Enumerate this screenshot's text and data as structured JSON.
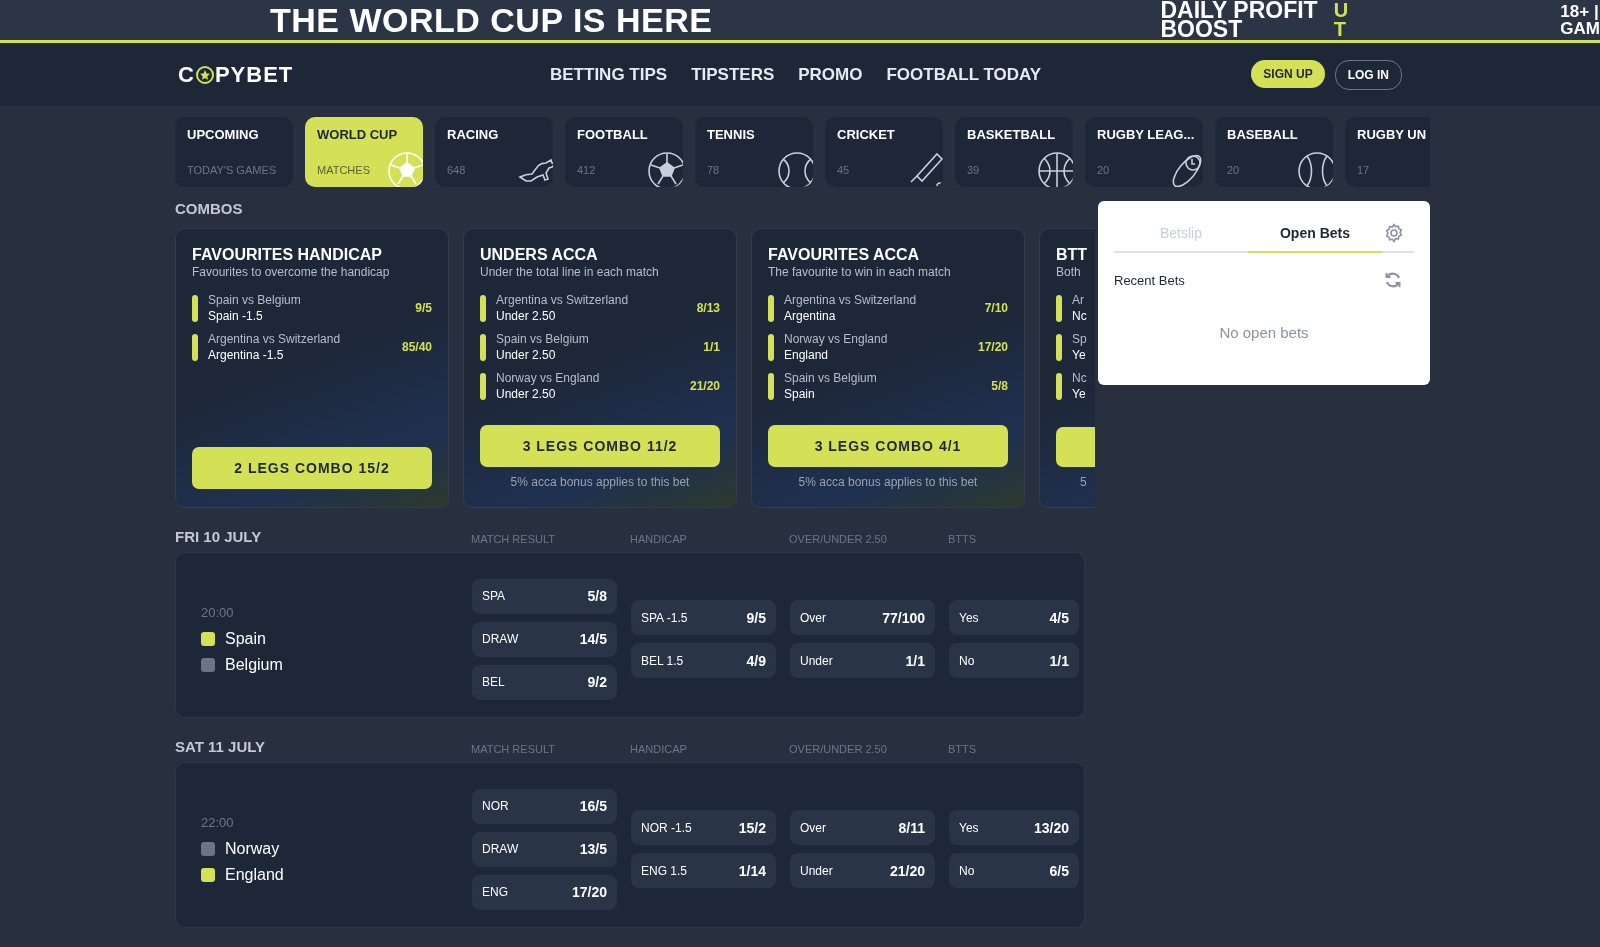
{
  "banner": {
    "headline": "THE WORLD CUP IS HERE",
    "promo_line_1": "DAILY PROFIT",
    "promo_line_2": "BOOST",
    "accent_1": "U",
    "accent_2": "T",
    "age_1": "18+ |",
    "age_2": "GAM"
  },
  "nav": {
    "logo_start": "C",
    "logo_end": "PYBET",
    "links": [
      "BETTING TIPS",
      "TIPSTERS",
      "PROMO",
      "FOOTBALL TODAY"
    ],
    "sign_up": "SIGN UP",
    "log_in": "LOG IN"
  },
  "categories": [
    {
      "title": "UPCOMING",
      "subtitle": "TODAY'S GAMES",
      "selected": false
    },
    {
      "title": "WORLD CUP",
      "subtitle": "MATCHES",
      "selected": true,
      "kind": "soccer"
    },
    {
      "title": "RACING",
      "subtitle": "648",
      "selected": false,
      "kind": "horse"
    },
    {
      "title": "FOOTBALL",
      "subtitle": "412",
      "selected": false,
      "kind": "soccer"
    },
    {
      "title": "TENNIS",
      "subtitle": "78",
      "selected": false,
      "kind": "tennis"
    },
    {
      "title": "CRICKET",
      "subtitle": "45",
      "selected": false,
      "kind": "cricket"
    },
    {
      "title": "BASKETBALL",
      "subtitle": "39",
      "selected": false,
      "kind": "basketball"
    },
    {
      "title": "RUGBY LEAG...",
      "subtitle": "20",
      "selected": false,
      "kind": "rugby"
    },
    {
      "title": "BASEBALL",
      "subtitle": "20",
      "selected": false,
      "kind": "baseball"
    },
    {
      "title": "RUGBY UN",
      "subtitle": "17",
      "selected": false
    }
  ],
  "combos": {
    "heading": "COMBOS",
    "cards": [
      {
        "title": "FAVOURITES HANDICAP",
        "subtitle": "Favourites to overcome the handicap",
        "legs": [
          {
            "match": "Spain vs Belgium",
            "pick": "Spain -1.5",
            "odds": "9/5"
          },
          {
            "match": "Argentina vs Switzerland",
            "pick": "Argentina -1.5",
            "odds": "85/40"
          }
        ],
        "button": "2 LEGS COMBO 15/2"
      },
      {
        "title": "UNDERS ACCA",
        "subtitle": "Under the total line in each match",
        "legs": [
          {
            "match": "Argentina vs Switzerland",
            "pick": "Under 2.50",
            "odds": "8/13"
          },
          {
            "match": "Spain vs Belgium",
            "pick": "Under 2.50",
            "odds": "1/1"
          },
          {
            "match": "Norway vs England",
            "pick": "Under 2.50",
            "odds": "21/20"
          }
        ],
        "button": "3 LEGS COMBO 11/2",
        "note": "5% acca bonus applies to this bet"
      },
      {
        "title": "FAVOURITES ACCA",
        "subtitle": "The favourite to win in each match",
        "legs": [
          {
            "match": "Argentina vs Switzerland",
            "pick": "Argentina",
            "odds": "7/10"
          },
          {
            "match": "Norway vs England",
            "pick": "England",
            "odds": "17/20"
          },
          {
            "match": "Spain vs Belgium",
            "pick": "Spain",
            "odds": "5/8"
          }
        ],
        "button": "3 LEGS COMBO 4/1",
        "note": "5% acca bonus applies to this bet"
      },
      {
        "title": "BTT",
        "subtitle": "Both",
        "legs": [
          {
            "match": "Ar",
            "pick": "Nc"
          },
          {
            "match": "Sp",
            "pick": "Ye"
          },
          {
            "match": "Nc",
            "pick": "Ye"
          }
        ],
        "note": "5"
      }
    ]
  },
  "days": [
    {
      "date": "FRI 10 JULY",
      "columns": [
        "MATCH RESULT",
        "HANDICAP",
        "OVER/UNDER 2.50",
        "BTTS"
      ],
      "match": {
        "time": "20:00",
        "teams": [
          {
            "name": "Spain",
            "color": "#d4e157"
          },
          {
            "name": "Belgium",
            "color": "#6b7587"
          }
        ],
        "markets": [
          [
            {
              "label": "SPA",
              "odds": "5/8"
            },
            {
              "label": "DRAW",
              "odds": "14/5"
            },
            {
              "label": "BEL",
              "odds": "9/2"
            }
          ],
          [
            {
              "label": "SPA -1.5",
              "odds": "9/5"
            },
            {
              "label": "BEL 1.5",
              "odds": "4/9"
            }
          ],
          [
            {
              "label": "Over",
              "odds": "77/100"
            },
            {
              "label": "Under",
              "odds": "1/1"
            }
          ],
          [
            {
              "label": "Yes",
              "odds": "4/5"
            },
            {
              "label": "No",
              "odds": "1/1"
            }
          ]
        ]
      }
    },
    {
      "date": "SAT 11 JULY",
      "columns": [
        "MATCH RESULT",
        "HANDICAP",
        "OVER/UNDER 2.50",
        "BTTS"
      ],
      "match": {
        "time": "22:00",
        "teams": [
          {
            "name": "Norway",
            "color": "#6b7587"
          },
          {
            "name": "England",
            "color": "#d4e157"
          }
        ],
        "markets": [
          [
            {
              "label": "NOR",
              "odds": "16/5"
            },
            {
              "label": "DRAW",
              "odds": "13/5"
            },
            {
              "label": "ENG",
              "odds": "17/20"
            }
          ],
          [
            {
              "label": "NOR -1.5",
              "odds": "15/2"
            },
            {
              "label": "ENG 1.5",
              "odds": "1/14"
            }
          ],
          [
            {
              "label": "Over",
              "odds": "8/11"
            },
            {
              "label": "Under",
              "odds": "21/20"
            }
          ],
          [
            {
              "label": "Yes",
              "odds": "13/20"
            },
            {
              "label": "No",
              "odds": "6/5"
            }
          ]
        ]
      }
    }
  ],
  "betslip": {
    "tabs": [
      {
        "label": "Betslip",
        "selected": false
      },
      {
        "label": "Open Bets",
        "selected": true
      }
    ],
    "section": "Recent Bets",
    "empty": "No open bets"
  }
}
